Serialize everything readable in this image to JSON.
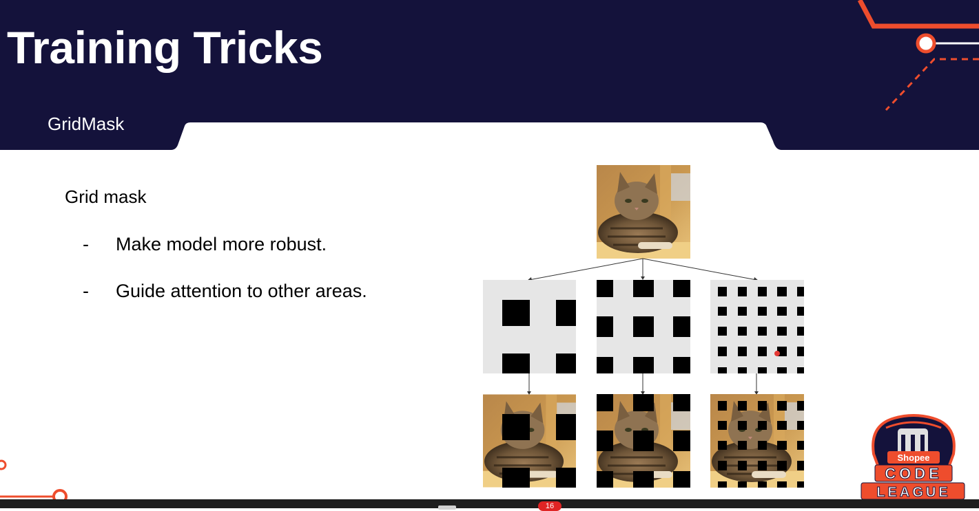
{
  "slide": {
    "title": "Training Tricks",
    "subtitle": "GridMask",
    "heading": "Grid mask",
    "bullets": [
      {
        "marker": "-",
        "text": "Make model more robust."
      },
      {
        "marker": "-",
        "text": "Guide attention to other areas."
      }
    ]
  },
  "logo": {
    "brand": "Shopee",
    "line1": "CODE",
    "line2": "LEAGUE"
  },
  "taskbar": {
    "badge_count": "16"
  },
  "colors": {
    "header_navy": "#14123b",
    "accent_red": "#ee4d2d",
    "mask_gray": "#e6e6e6",
    "mask_black": "#000000"
  }
}
